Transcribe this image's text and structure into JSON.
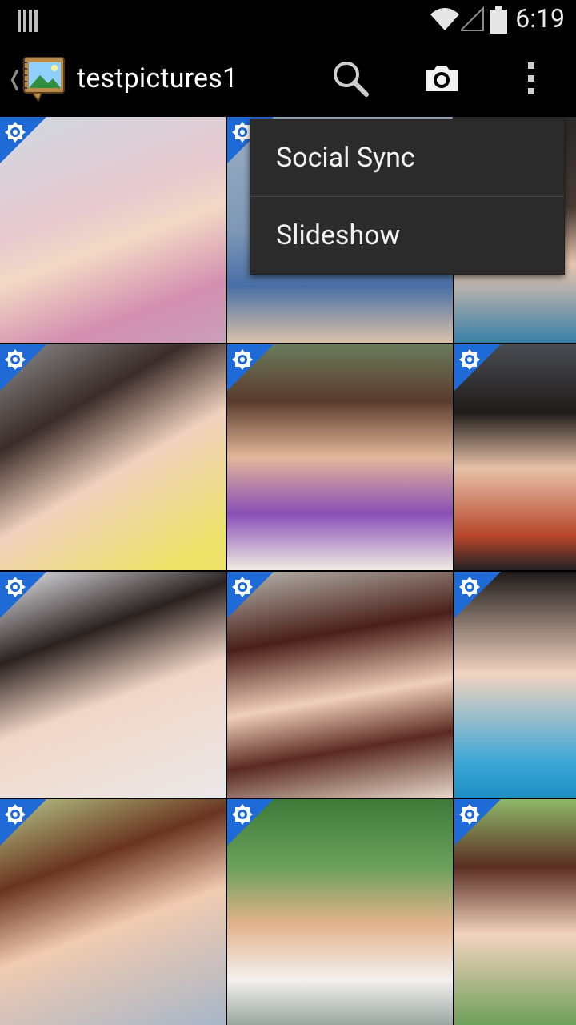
{
  "status_bar": {
    "time": "6:19",
    "icons": [
      "notification-icon",
      "wifi-icon",
      "signal-icon",
      "battery-icon"
    ]
  },
  "action_bar": {
    "title": "testpictures1",
    "icons": [
      "up-caret-icon",
      "gallery-album-icon",
      "search-icon",
      "camera-icon",
      "overflow-menu-icon"
    ]
  },
  "overflow_menu": {
    "items": [
      "Social Sync",
      "Slideshow"
    ]
  },
  "grid": {
    "columns": 3,
    "rows": 4,
    "badge_icon": "camera-badge-icon",
    "badge_color": "#1e6ad6"
  },
  "colors": {
    "background": "#000000",
    "menu_bg": "#2b2b2b",
    "badge": "#1e6ad6"
  }
}
